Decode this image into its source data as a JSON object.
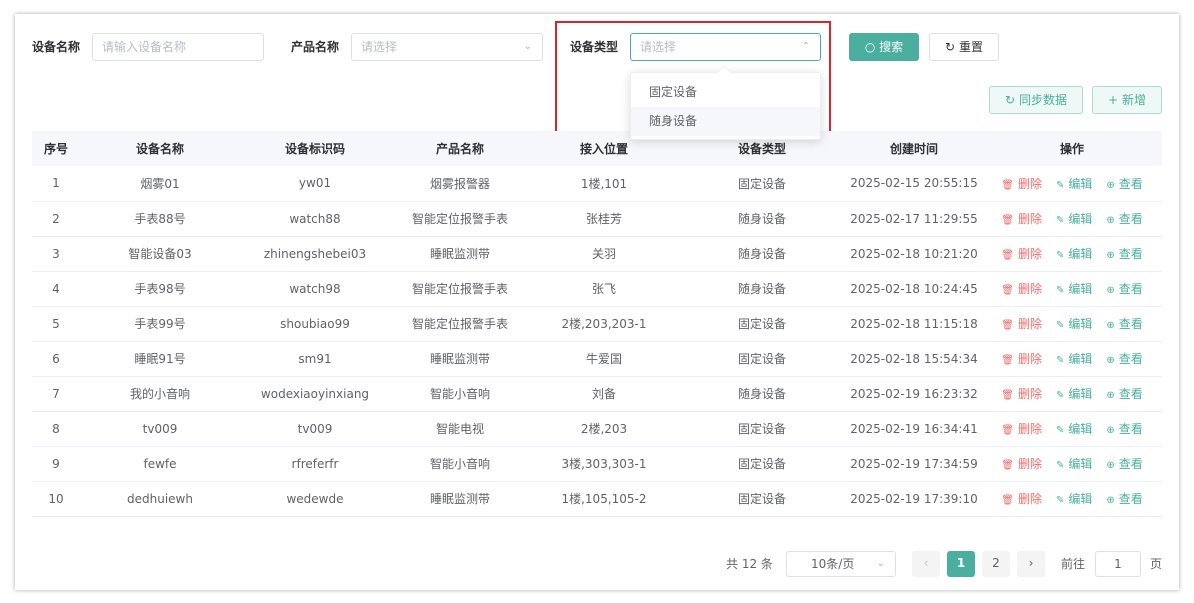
{
  "filters": {
    "device_name_label": "设备名称",
    "device_name_placeholder": "请输入设备名称",
    "product_name_label": "产品名称",
    "product_name_placeholder": "请选择",
    "device_type_label": "设备类型",
    "device_type_placeholder": "请选择",
    "device_type_options": [
      "固定设备",
      "随身设备"
    ]
  },
  "buttons": {
    "search": "搜索",
    "reset": "重置",
    "sync": "同步数据",
    "add": "新增"
  },
  "icons": {
    "search": "search-icon",
    "reset": "refresh-icon",
    "sync": "refresh-icon",
    "add": "plus-icon",
    "delete": "trash-icon",
    "edit": "edit-icon",
    "view": "view-icon"
  },
  "colors": {
    "primary": "#4aaf9f",
    "danger": "#f56c6c",
    "highlight_box": "#d9262c"
  },
  "table": {
    "columns": [
      "序号",
      "设备名称",
      "设备标识码",
      "产品名称",
      "接入位置",
      "设备类型",
      "创建时间",
      "操作"
    ],
    "actions": {
      "delete": "删除",
      "edit": "编辑",
      "view": "查看"
    },
    "rows": [
      [
        "1",
        "烟雾01",
        "yw01",
        "烟雾报警器",
        "1楼,101",
        "固定设备",
        "2025-02-15 20:55:15"
      ],
      [
        "2",
        "手表88号",
        "watch88",
        "智能定位报警手表",
        "张桂芳",
        "随身设备",
        "2025-02-17 11:29:55"
      ],
      [
        "3",
        "智能设备03",
        "zhinengshebei03",
        "睡眠监测带",
        "关羽",
        "随身设备",
        "2025-02-18 10:21:20"
      ],
      [
        "4",
        "手表98号",
        "watch98",
        "智能定位报警手表",
        "张飞",
        "随身设备",
        "2025-02-18 10:24:45"
      ],
      [
        "5",
        "手表99号",
        "shoubiao99",
        "智能定位报警手表",
        "2楼,203,203-1",
        "固定设备",
        "2025-02-18 11:15:18"
      ],
      [
        "6",
        "睡眠91号",
        "sm91",
        "睡眠监测带",
        "牛爱国",
        "固定设备",
        "2025-02-18 15:54:34"
      ],
      [
        "7",
        "我的小音响",
        "wodexiaoyinxiang",
        "智能小音响",
        "刘备",
        "随身设备",
        "2025-02-19 16:23:32"
      ],
      [
        "8",
        "tv009",
        "tv009",
        "智能电视",
        "2楼,203",
        "固定设备",
        "2025-02-19 16:34:41"
      ],
      [
        "9",
        "fewfe",
        "rfreferfr",
        "智能小音响",
        "3楼,303,303-1",
        "固定设备",
        "2025-02-19 17:34:59"
      ],
      [
        "10",
        "dedhuiewh",
        "wedewde",
        "睡眠监测带",
        "1楼,105,105-2",
        "固定设备",
        "2025-02-19 17:39:10"
      ]
    ]
  },
  "pagination": {
    "total": "共 12 条",
    "page_size": "10条/页",
    "pages": [
      "1",
      "2"
    ],
    "current": "1",
    "goto_label": "前往",
    "goto_value": "1",
    "goto_unit": "页"
  }
}
